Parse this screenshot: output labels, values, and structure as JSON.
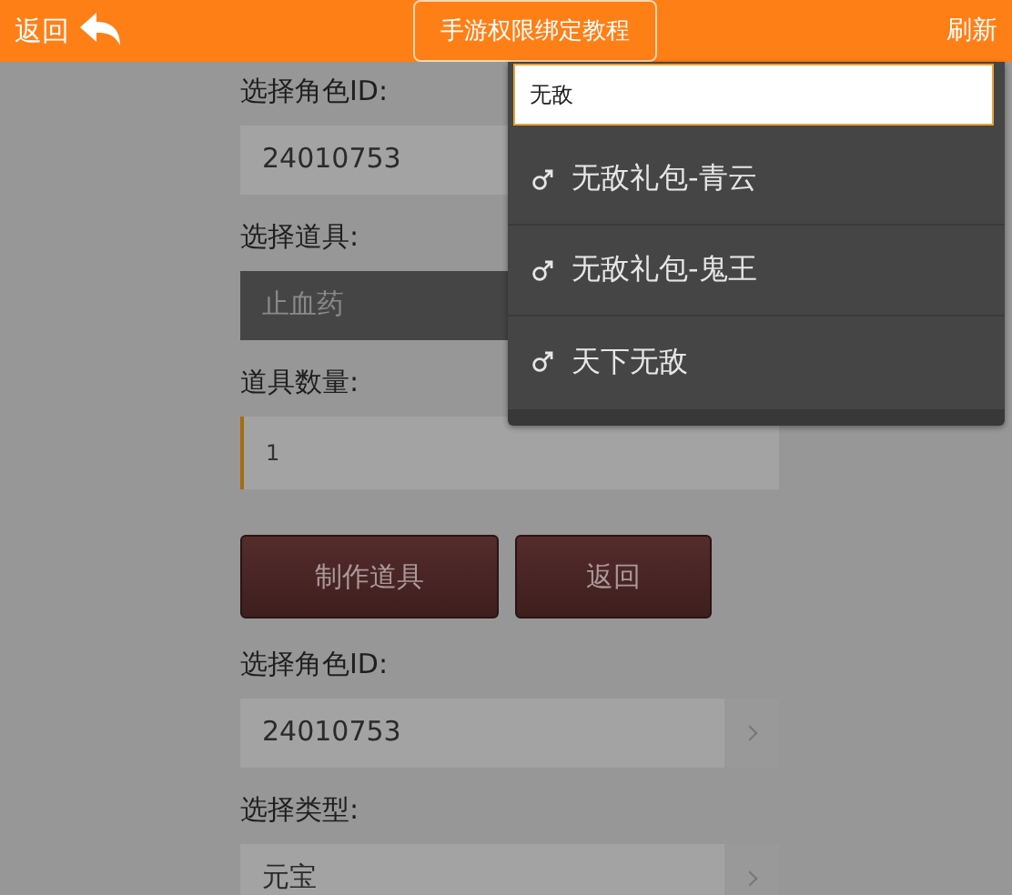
{
  "header": {
    "back": "返回",
    "title_button": "手游权限绑定教程",
    "refresh": "刷新"
  },
  "form": [
    {
      "kind": "label",
      "text": "选择角色ID:"
    },
    {
      "kind": "select",
      "value": "24010753"
    },
    {
      "kind": "label",
      "text": "选择道具:"
    },
    {
      "kind": "dark-select",
      "value": "止血药"
    },
    {
      "kind": "label",
      "text": "道具数量:"
    },
    {
      "kind": "input",
      "value": "1",
      "focused": true
    },
    {
      "kind": "buttons",
      "buttons": [
        "制作道具",
        "返回"
      ]
    },
    {
      "kind": "label",
      "text": "选择角色ID:"
    },
    {
      "kind": "select",
      "value": "24010753"
    },
    {
      "kind": "label",
      "text": "选择类型:"
    },
    {
      "kind": "select",
      "value": "元宝"
    }
  ],
  "dropdown": {
    "search": "无敌",
    "items": [
      {
        "label": "无敌礼包-青云"
      },
      {
        "label": "无敌礼包-鬼王"
      },
      {
        "label": "天下无敌"
      }
    ]
  }
}
